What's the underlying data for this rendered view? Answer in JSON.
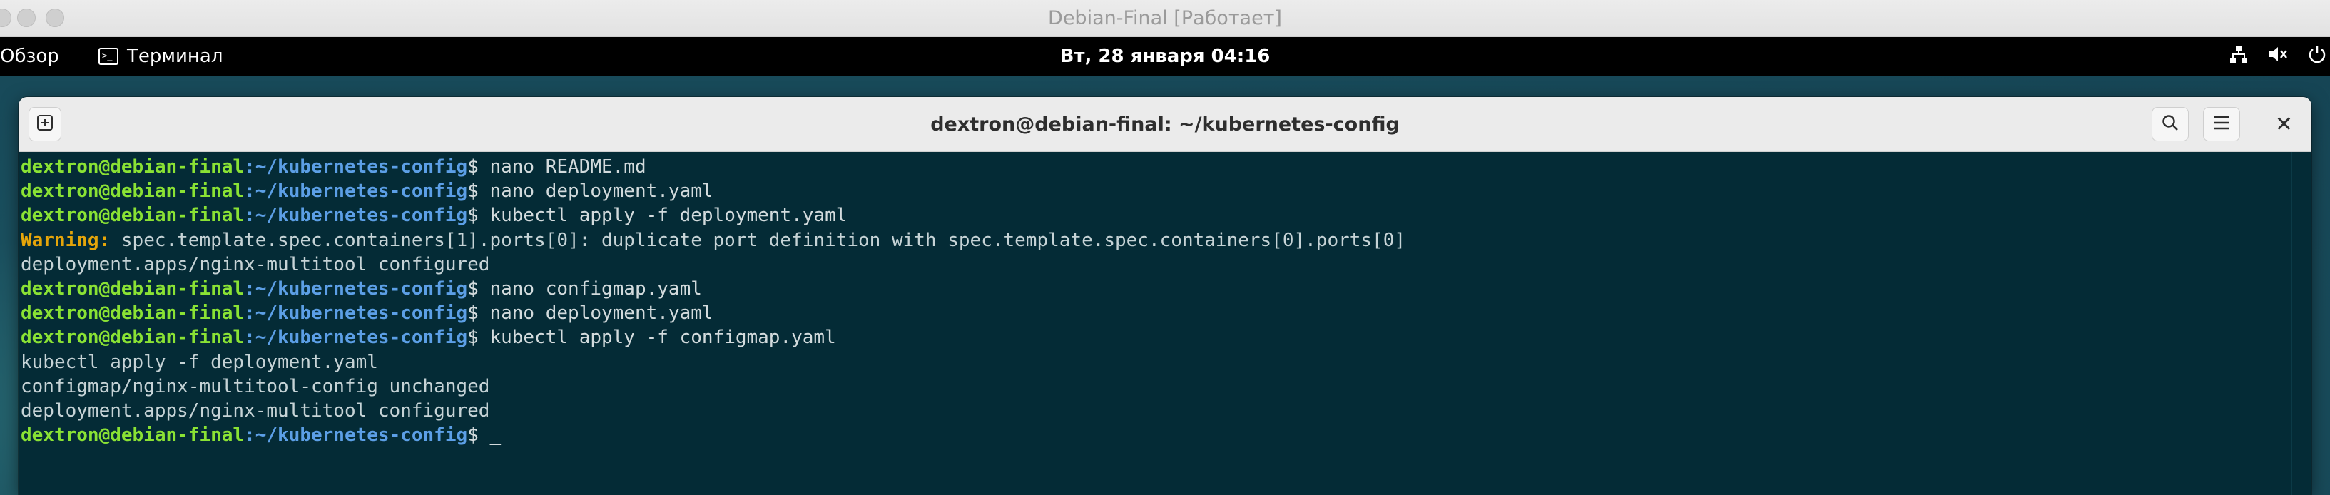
{
  "host_window": {
    "title": "Debian-Final [Работает]"
  },
  "gnome_bar": {
    "overview": "Обзор",
    "app_name": "Терминал",
    "clock": "Вт, 28 января  04:16",
    "tray_icons": [
      "network-icon",
      "volume-muted-icon",
      "power-icon"
    ]
  },
  "terminal": {
    "title": "dextron@debian-final: ~/kubernetes-config",
    "new_tab_icon": "new-tab-icon",
    "search_icon": "search-icon",
    "menu_icon": "hamburger-menu-icon",
    "close_icon": "close-icon",
    "prompt": {
      "user_host": "dextron@debian-final",
      "path": ":~/kubernetes-config",
      "symbol": "$ "
    },
    "lines": [
      {
        "type": "prompt",
        "cmd": "nano README.md"
      },
      {
        "type": "prompt",
        "cmd": "nano deployment.yaml"
      },
      {
        "type": "prompt",
        "cmd": "kubectl apply -f deployment.yaml"
      },
      {
        "type": "warning",
        "label": "Warning:",
        "text": " spec.template.spec.containers[1].ports[0]: duplicate port definition with spec.template.spec.containers[0].ports[0]"
      },
      {
        "type": "output",
        "text": "deployment.apps/nginx-multitool configured"
      },
      {
        "type": "prompt",
        "cmd": "nano configmap.yaml"
      },
      {
        "type": "prompt",
        "cmd": "nano deployment.yaml"
      },
      {
        "type": "prompt",
        "cmd": "kubectl apply -f configmap.yaml"
      },
      {
        "type": "output",
        "text": "kubectl apply -f deployment.yaml"
      },
      {
        "type": "output",
        "text": "configmap/nginx-multitool-config unchanged"
      },
      {
        "type": "output",
        "text": "deployment.apps/nginx-multitool configured"
      },
      {
        "type": "prompt",
        "cmd": "",
        "cursor": "_"
      }
    ]
  },
  "colors": {
    "terminal_bg": "#042b36",
    "prompt_user": "#8ae234",
    "prompt_path": "#5c9fe6",
    "warning": "#e5a50a",
    "text": "#c6d3d6"
  }
}
